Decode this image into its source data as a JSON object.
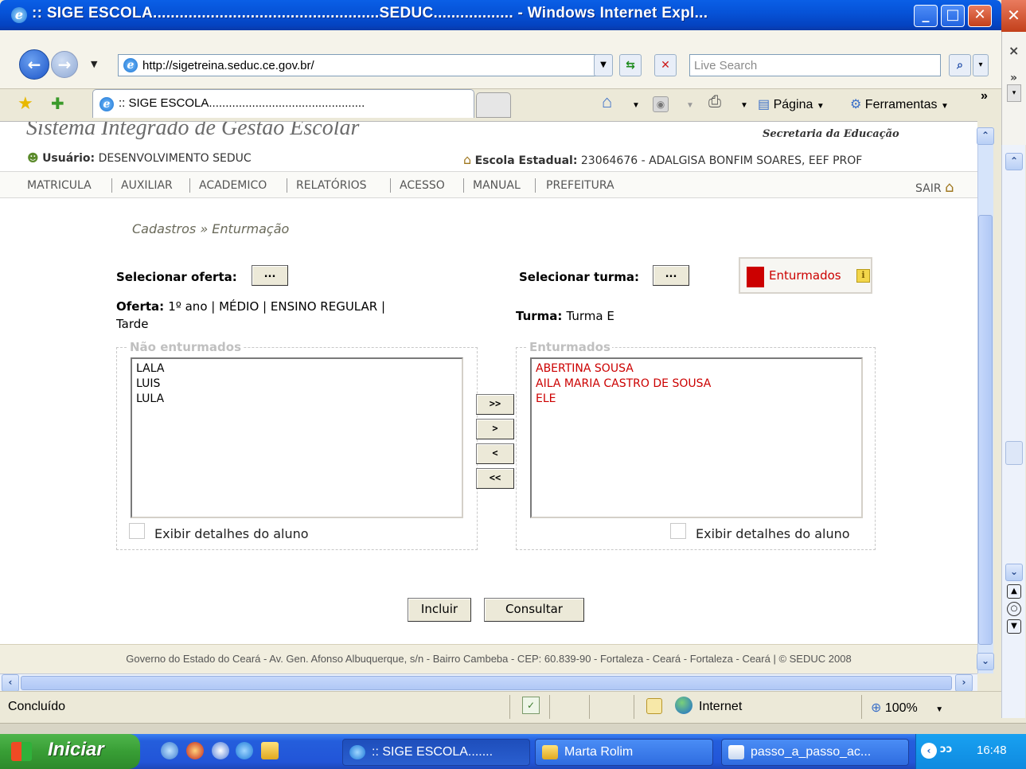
{
  "window": {
    "title": ":: SIGE ESCOLA...................................................SEDUC.................. - Windows Internet Expl...",
    "minimize": "_",
    "maximize": "□",
    "close": "✕"
  },
  "browser": {
    "address": "http://sigetreina.seduc.ce.gov.br/",
    "search_placeholder": "Live Search",
    "tab_title": ":: SIGE ESCOLA...............................................",
    "cmd_pagina": "Página",
    "cmd_ferramentas": "Ferramentas",
    "chevron": "»"
  },
  "site": {
    "system_name": "Sistema Integrado de Gestão Escolar",
    "secretaria": "Secretaria da Educação",
    "user_label": "Usuário:",
    "user_value": "DESENVOLVIMENTO SEDUC",
    "school_label": "Escola Estadual:",
    "school_value": "23064676 - ADALGISA BONFIM SOARES, EEF PROF",
    "menu": [
      "MATRICULA",
      "AUXILIAR",
      "ACADEMICO",
      "RELATÓRIOS",
      "ACESSO",
      "MANUAL",
      "PREFEITURA"
    ],
    "logout": "SAIR"
  },
  "form": {
    "breadcrumb": "Cadastros » Enturmação",
    "select_offer_label": "Selecionar oferta:",
    "select_class_label": "Selecionar turma:",
    "dots": "...",
    "legend_label": "Enturmados",
    "legend_info": "i",
    "offer_label": "Oferta:",
    "offer_value_line1": "1º ano | MÉDIO | ENSINO REGULAR |",
    "offer_value_line2": "Tarde",
    "class_label": "Turma:",
    "class_value": "Turma E",
    "left_group": "Não enturmados",
    "right_group": "Enturmados",
    "left_list": [
      "LALA",
      "LUIS",
      "LULA"
    ],
    "right_list": [
      "ABERTINA SOUSA",
      "AILA MARIA CASTRO DE SOUSA",
      "ELE"
    ],
    "move_all_right": ">>",
    "move_right": ">",
    "move_left": "<",
    "move_all_left": "<<",
    "show_details": "Exibir detalhes do aluno",
    "include": "Incluir",
    "consult": "Consultar"
  },
  "footer": "Governo do Estado do Ceará - Av. Gen. Afonso Albuquerque, s/n - Bairro Cambeba - CEP: 60.839-90 - Fortaleza - Ceará - Fortaleza - Ceará | © SEDUC 2008",
  "status": {
    "text": "Concluído",
    "zone": "Internet",
    "zoom": "100%"
  },
  "taskbar": {
    "start": "Iniciar",
    "tasks": [
      ":: SIGE ESCOLA.......",
      "Marta Rolim",
      "passo_a_passo_ac..."
    ],
    "clock": "16:48"
  },
  "colors": {
    "xp_blue": "#0653d8",
    "enturmados_red": "#cc0000",
    "start_green": "#389e35"
  }
}
